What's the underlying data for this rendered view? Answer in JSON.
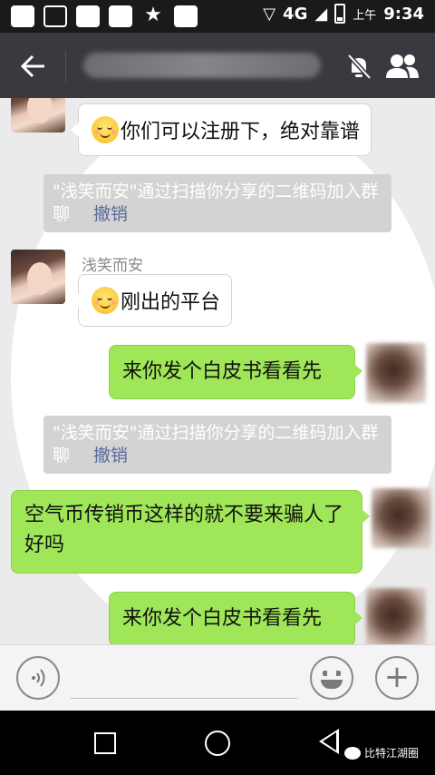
{
  "status_bar": {
    "network": "4G",
    "ampm": "上午",
    "time": "9:34"
  },
  "header": {
    "title": "",
    "back_icon": "back-arrow-icon",
    "mute_icon": "mute-bell-icon",
    "members_icon": "group-members-icon"
  },
  "messages": [
    {
      "type": "incoming",
      "sender": "",
      "text": "你们可以注册下，绝对靠谱",
      "emoji": "shy-smile"
    },
    {
      "type": "system",
      "text": "\"浅笑而安\"通过扫描你分享的二维码加入群聊",
      "action": "撤销"
    },
    {
      "type": "incoming",
      "sender": "浅笑而安",
      "text": "刚出的平台",
      "emoji": "shy-smile"
    },
    {
      "type": "outgoing",
      "text": "来你发个白皮书看看先"
    },
    {
      "type": "system",
      "text": "\"浅笑而安\"通过扫描你分享的二维码加入群聊",
      "action": "撤销"
    },
    {
      "type": "outgoing",
      "text": "空气币传销币这样的就不要来骗人了好吗"
    },
    {
      "type": "outgoing",
      "text": "来你发个白皮书看看先"
    }
  ],
  "input_bar": {
    "voice_icon": "voice-icon",
    "emoji_icon": "emoji-face-icon",
    "plus_icon": "plus-icon"
  },
  "nav_bar": {
    "watermark": "比特江湖圈"
  }
}
